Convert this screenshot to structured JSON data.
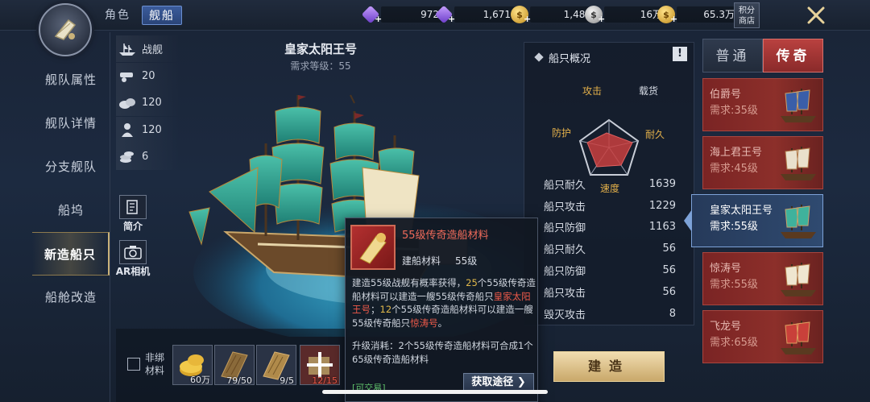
{
  "header": {
    "tabs": [
      {
        "label": "角色"
      },
      {
        "label": "舰船"
      }
    ],
    "currencies": [
      {
        "icon": "purple-gem-icon",
        "value": "972"
      },
      {
        "icon": "bound-purple-gem-icon",
        "value": "1,671"
      },
      {
        "icon": "gold-coin-icon",
        "value": "1,481"
      },
      {
        "icon": "silver-coin-icon",
        "value": "16万"
      },
      {
        "icon": "gold-coin-stack-icon",
        "value": "65.3万"
      }
    ],
    "shop_label_line1": "积分",
    "shop_label_line2": "商店"
  },
  "sidebar": {
    "items": [
      {
        "label": "舰队属性"
      },
      {
        "label": "舰队详情"
      },
      {
        "label": "分支舰队"
      },
      {
        "label": "船坞"
      },
      {
        "label": "新造船只"
      },
      {
        "label": "船舱改造"
      }
    ],
    "active_index": 4
  },
  "stats": [
    {
      "icon": "warship-icon",
      "value": "战舰"
    },
    {
      "icon": "cannon-icon",
      "value": "20"
    },
    {
      "icon": "cargo-icon",
      "value": "120"
    },
    {
      "icon": "sailor-icon",
      "value": "120"
    },
    {
      "icon": "coins-icon",
      "value": "6"
    }
  ],
  "side_buttons": {
    "intro": "简介",
    "ar": "AR相机"
  },
  "ship": {
    "name": "皇家太阳王号",
    "requirement": "需求等级：55"
  },
  "overview": {
    "title": "船只概况",
    "info": "!",
    "radar_labels": {
      "top_left": "攻击",
      "top_right": "载货",
      "left": "防护",
      "right": "耐久",
      "bottom": "速度"
    },
    "rows": [
      {
        "label": "船只耐久",
        "value": "1639"
      },
      {
        "label": "船只攻击",
        "value": "1229"
      },
      {
        "label": "船只防御",
        "value": "1163"
      },
      {
        "label": "船只耐久",
        "value": "56"
      },
      {
        "label": "船只防御",
        "value": "56"
      },
      {
        "label": "船只攻击",
        "value": "56"
      },
      {
        "label": "毁灭攻击",
        "value": "8"
      }
    ]
  },
  "right_tabs": {
    "normal": "普通",
    "legend": "传奇"
  },
  "ship_list": [
    {
      "name": "伯爵号",
      "req": "需求:35级"
    },
    {
      "name": "海上君王号",
      "req": "需求:45级"
    },
    {
      "name": "皇家太阳王号",
      "req": "需求:55级",
      "selected": true
    },
    {
      "name": "惊涛号",
      "req": "需求:55级"
    },
    {
      "name": "飞龙号",
      "req": "需求:65级"
    }
  ],
  "tooltip": {
    "title": "55级传奇造船材料",
    "type": "建船材料",
    "level": "55级",
    "desc_a": "建造55级战舰有概率获得，",
    "desc_b": "25",
    "desc_c": "个55级传奇造船材料可以建造一艘55级传奇船只",
    "desc_d": "皇家太阳王号",
    "desc_e": "；",
    "desc_f": "12",
    "desc_g": "个55级传奇造船材料可以建造一艘55级传奇船只",
    "desc_h": "惊涛号",
    "desc_i": "。",
    "upg_a": "升级消耗：",
    "upg_b": "2",
    "upg_c": "个55级传奇造船材料可合成1个65级传奇造船材料",
    "trade": "[可交易]",
    "button": "获取途径"
  },
  "bottom": {
    "checkbox_label_line1": "非绑",
    "checkbox_label_line2": "材料",
    "materials": [
      {
        "icon": "gold-coins-icon",
        "qty": "60万"
      },
      {
        "icon": "wood-plank-icon",
        "qty": "79/50"
      },
      {
        "icon": "wood-plank-icon",
        "qty": "9/5"
      },
      {
        "icon": "legend-material-icon",
        "qty": "12/15",
        "insufficient": true
      }
    ],
    "build_label": "建造"
  }
}
